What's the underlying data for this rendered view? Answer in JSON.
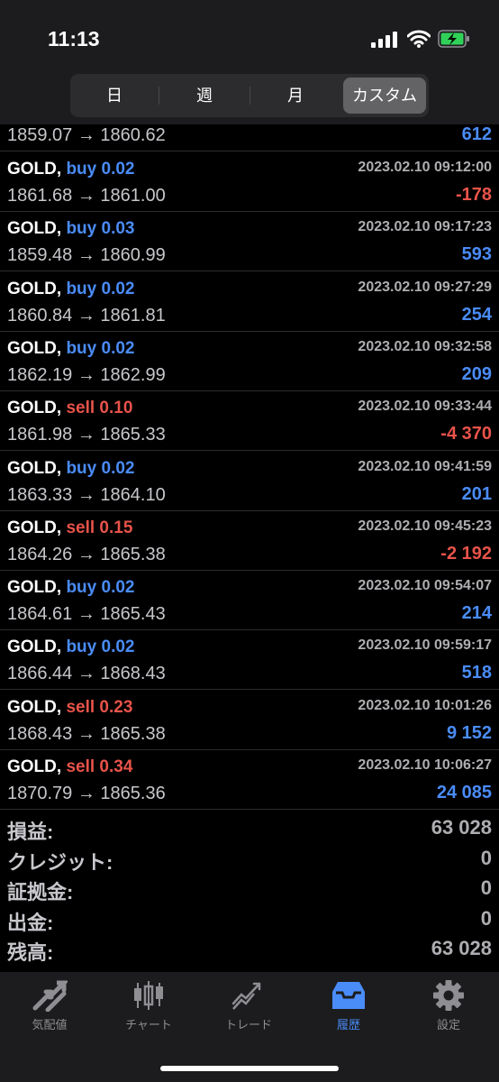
{
  "status": {
    "time": "11:13"
  },
  "segments": [
    "日",
    "週",
    "月",
    "カスタム"
  ],
  "active_segment": "カスタム",
  "top_partial": {
    "prices": "1859.07 → 1860.62",
    "profit": "612",
    "profit_sign": "pos"
  },
  "trades": [
    {
      "symbol": "GOLD,",
      "side": "buy",
      "lots": "buy 0.02",
      "datetime": "2023.02.10 09:12:00",
      "prices": "1861.68 → 1861.00",
      "profit": "-178"
    },
    {
      "symbol": "GOLD,",
      "side": "buy",
      "lots": "buy 0.03",
      "datetime": "2023.02.10 09:17:23",
      "prices": "1859.48 → 1860.99",
      "profit": "593"
    },
    {
      "symbol": "GOLD,",
      "side": "buy",
      "lots": "buy 0.02",
      "datetime": "2023.02.10 09:27:29",
      "prices": "1860.84 → 1861.81",
      "profit": "254"
    },
    {
      "symbol": "GOLD,",
      "side": "buy",
      "lots": "buy 0.02",
      "datetime": "2023.02.10 09:32:58",
      "prices": "1862.19 → 1862.99",
      "profit": "209"
    },
    {
      "symbol": "GOLD,",
      "side": "sell",
      "lots": "sell 0.10",
      "datetime": "2023.02.10 09:33:44",
      "prices": "1861.98 → 1865.33",
      "profit": "-4 370"
    },
    {
      "symbol": "GOLD,",
      "side": "buy",
      "lots": "buy 0.02",
      "datetime": "2023.02.10 09:41:59",
      "prices": "1863.33 → 1864.10",
      "profit": "201"
    },
    {
      "symbol": "GOLD,",
      "side": "sell",
      "lots": "sell 0.15",
      "datetime": "2023.02.10 09:45:23",
      "prices": "1864.26 → 1865.38",
      "profit": "-2 192"
    },
    {
      "symbol": "GOLD,",
      "side": "buy",
      "lots": "buy 0.02",
      "datetime": "2023.02.10 09:54:07",
      "prices": "1864.61 → 1865.43",
      "profit": "214"
    },
    {
      "symbol": "GOLD,",
      "side": "buy",
      "lots": "buy 0.02",
      "datetime": "2023.02.10 09:59:17",
      "prices": "1866.44 → 1868.43",
      "profit": "518"
    },
    {
      "symbol": "GOLD,",
      "side": "sell",
      "lots": "sell 0.23",
      "datetime": "2023.02.10 10:01:26",
      "prices": "1868.43 → 1865.38",
      "profit": "9 152"
    },
    {
      "symbol": "GOLD,",
      "side": "sell",
      "lots": "sell 0.34",
      "datetime": "2023.02.10 10:06:27",
      "prices": "1870.79 → 1865.36",
      "profit": "24 085"
    }
  ],
  "summary": [
    {
      "label": "損益:",
      "value": "63 028"
    },
    {
      "label": "クレジット:",
      "value": "0"
    },
    {
      "label": "証拠金:",
      "value": "0"
    },
    {
      "label": "出金:",
      "value": "0"
    },
    {
      "label": "残高:",
      "value": "63 028"
    }
  ],
  "tabs": [
    {
      "label": "気配値",
      "icon": "quotes-arrows-icon"
    },
    {
      "label": "チャート",
      "icon": "candlestick-chart-icon"
    },
    {
      "label": "トレード",
      "icon": "trade-line-icon"
    },
    {
      "label": "履歴",
      "icon": "history-tray-icon"
    },
    {
      "label": "設定",
      "icon": "gear-icon"
    }
  ],
  "active_tab": "履歴",
  "colors": {
    "buy": "#4a8cf7",
    "sell": "#e8534a",
    "active_tab": "#4a8cf7"
  }
}
